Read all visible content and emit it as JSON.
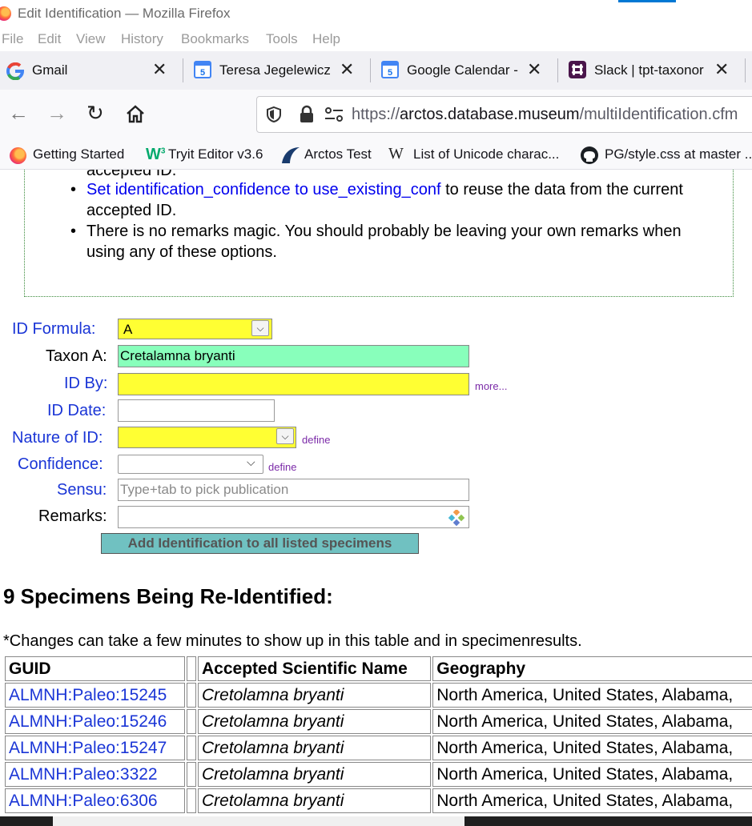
{
  "window": {
    "title": "Edit Identification — Mozilla Firefox"
  },
  "menu": [
    "File",
    "Edit",
    "View",
    "History",
    "Bookmarks",
    "Tools",
    "Help"
  ],
  "tabs": [
    {
      "label": "Gmail",
      "icon": "gmail-icon"
    },
    {
      "label": "Teresa Jegelewicz",
      "icon": "google-calendar-icon"
    },
    {
      "label": "Google Calendar -",
      "icon": "google-calendar-icon"
    },
    {
      "label": "Slack | tpt-taxonor",
      "icon": "slack-icon"
    }
  ],
  "url": {
    "scheme": "https://",
    "host": "arctos.database.museum",
    "path": "/multiIdentification.cfm"
  },
  "bookmarks": [
    "Getting Started",
    "Tryit Editor v3.6",
    "Arctos Test",
    "List of Unicode charac...",
    "PG/style.css at master ..."
  ],
  "notes": {
    "cut_line": "accepted ID.",
    "item1_link": "Set identification_confidence to use_existing_conf",
    "item1_rest": " to reuse the data from the current accepted ID.",
    "item2": "There is no remarks magic. You should probably be leaving your own remarks when using any of these options."
  },
  "form": {
    "id_formula_label": "ID Formula:",
    "id_formula_value": "A",
    "taxon_a_label": "Taxon A:",
    "taxon_a_value": "Cretalamna bryanti",
    "id_by_label": "ID By:",
    "id_by_more": "more...",
    "id_date_label": "ID Date:",
    "nature_label": "Nature of ID:",
    "nature_define": "define",
    "confidence_label": "Confidence:",
    "confidence_define": "define",
    "sensu_label": "Sensu:",
    "sensu_placeholder": "Type+tab to pick publication",
    "remarks_label": "Remarks:",
    "submit_label": "Add Identification to all listed specimens"
  },
  "results": {
    "heading": "9 Specimens Being Re-Identified:",
    "note": "*Changes can take a few minutes to show up in this table and in specimenresults.",
    "columns": [
      "GUID",
      "",
      "Accepted Scientific Name",
      "Geography"
    ],
    "rows": [
      {
        "guid": "ALMNH:Paleo:15245",
        "name": "Cretolamna bryanti",
        "geo": "North America, United States, Alabama,"
      },
      {
        "guid": "ALMNH:Paleo:15246",
        "name": "Cretolamna bryanti",
        "geo": "North America, United States, Alabama,"
      },
      {
        "guid": "ALMNH:Paleo:15247",
        "name": "Cretolamna bryanti",
        "geo": "North America, United States, Alabama,"
      },
      {
        "guid": "ALMNH:Paleo:3322",
        "name": "Cretolamna bryanti",
        "geo": "North America, United States, Alabama,"
      },
      {
        "guid": "ALMNH:Paleo:6306",
        "name": "Cretolamna bryanti",
        "geo": "North America, United States, Alabama,"
      }
    ]
  },
  "colors": {
    "link": "#1a35d6",
    "required": "#ffff33",
    "taxon": "#88ffbb",
    "button": "#70c1c1"
  }
}
